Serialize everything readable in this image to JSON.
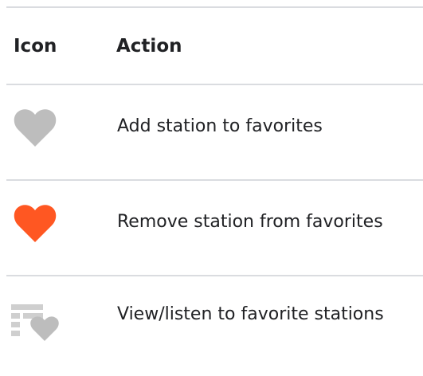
{
  "table": {
    "headers": {
      "icon": "Icon",
      "action": "Action"
    },
    "rows": [
      {
        "icon": "heart-outline-gray-icon",
        "icon_color": "#bdbdbd",
        "action": "Add station to favorites"
      },
      {
        "icon": "heart-filled-orange-icon",
        "icon_color": "#ff5722",
        "action": "Remove station from favorites"
      },
      {
        "icon": "favorites-list-icon",
        "icon_color": "#c4c4c4",
        "action": "View/listen to favorite stations"
      }
    ]
  },
  "colors": {
    "divider": "#dadce0",
    "text": "#202124"
  }
}
